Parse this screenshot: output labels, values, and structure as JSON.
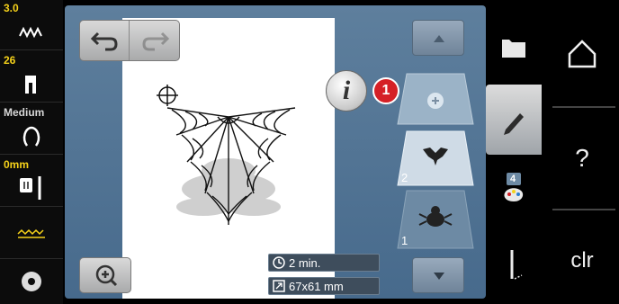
{
  "status_column": {
    "stitch_length": "3.0",
    "presser_foot": "26",
    "thread_tension": "Medium",
    "needle_position": "0mm"
  },
  "canvas": {
    "time_label": "2 min.",
    "size_label": "67x61 mm"
  },
  "badges": {
    "info_letter": "i",
    "callout_number": "1"
  },
  "layers": [
    {
      "number": "",
      "label": "add-layer"
    },
    {
      "number": "2",
      "label": "bat-motif"
    },
    {
      "number": "1",
      "label": "spider-motif"
    }
  ],
  "tabs": {
    "colors_count": "4"
  },
  "right_panel": {
    "help_label": "?",
    "clear_label": "clr"
  },
  "colors": {
    "panel": "#5e7f9d",
    "badge_red": "#d52026",
    "status_yellow": "#f6d21a"
  }
}
